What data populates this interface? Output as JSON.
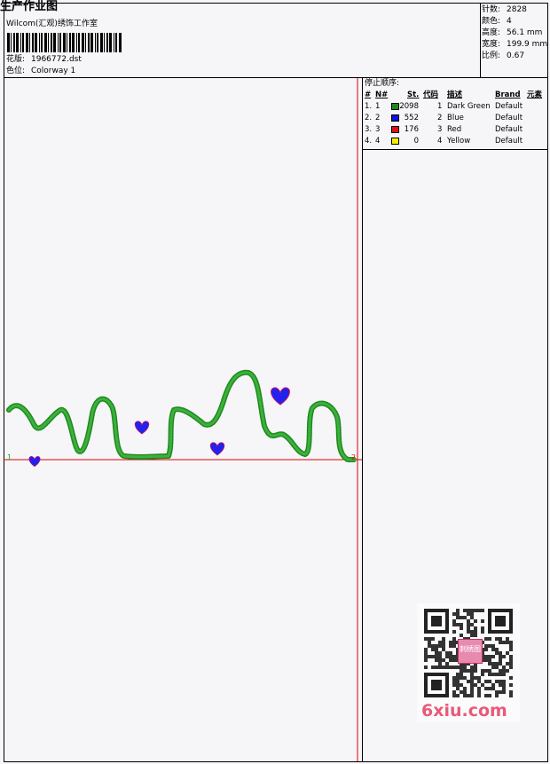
{
  "header": {
    "title": "生产作业图",
    "studio": "Wilcom(汇观)绣饰工作室",
    "design_label": "花版:",
    "design_value": "1966772.dst",
    "colorway_label": "色位:",
    "colorway_value": "Colorway 1"
  },
  "stats": {
    "stitches_label": "针数:",
    "stitches_value": "2828",
    "colors_label": "颜色:",
    "colors_value": "4",
    "height_label": "高度:",
    "height_value": "56.1 mm",
    "width_label": "宽度:",
    "width_value": "199.9 mm",
    "scale_label": "比例:",
    "scale_value": "0.67"
  },
  "stop_sequence": {
    "title": "停止顺序:",
    "columns": [
      "#",
      "N#",
      "St.",
      "代码",
      "描述",
      "Brand",
      "元素"
    ],
    "rows": [
      {
        "num": "1.",
        "n": "1",
        "color": "#1a8a1a",
        "st": "2098",
        "code": "1",
        "desc": "Dark Green",
        "brand": "Default"
      },
      {
        "num": "2.",
        "n": "2",
        "color": "#1010e0",
        "st": "552",
        "code": "2",
        "desc": "Blue",
        "brand": "Default"
      },
      {
        "num": "3.",
        "n": "3",
        "color": "#e01010",
        "st": "176",
        "code": "3",
        "desc": "Red",
        "brand": "Default"
      },
      {
        "num": "4.",
        "n": "4",
        "color": "#f0f000",
        "st": "0",
        "code": "4",
        "desc": "Yellow",
        "brand": "Default"
      }
    ]
  },
  "canvas": {
    "marker_start": "1",
    "marker_end": "2",
    "thread_colors": {
      "vine": "#2a9a2a",
      "heart_fill": "#2222ee",
      "heart_outline": "#d01060",
      "guide": "#e00000"
    }
  },
  "watermark": {
    "site": "6xiu.com",
    "qr_label": "刺绣图"
  }
}
